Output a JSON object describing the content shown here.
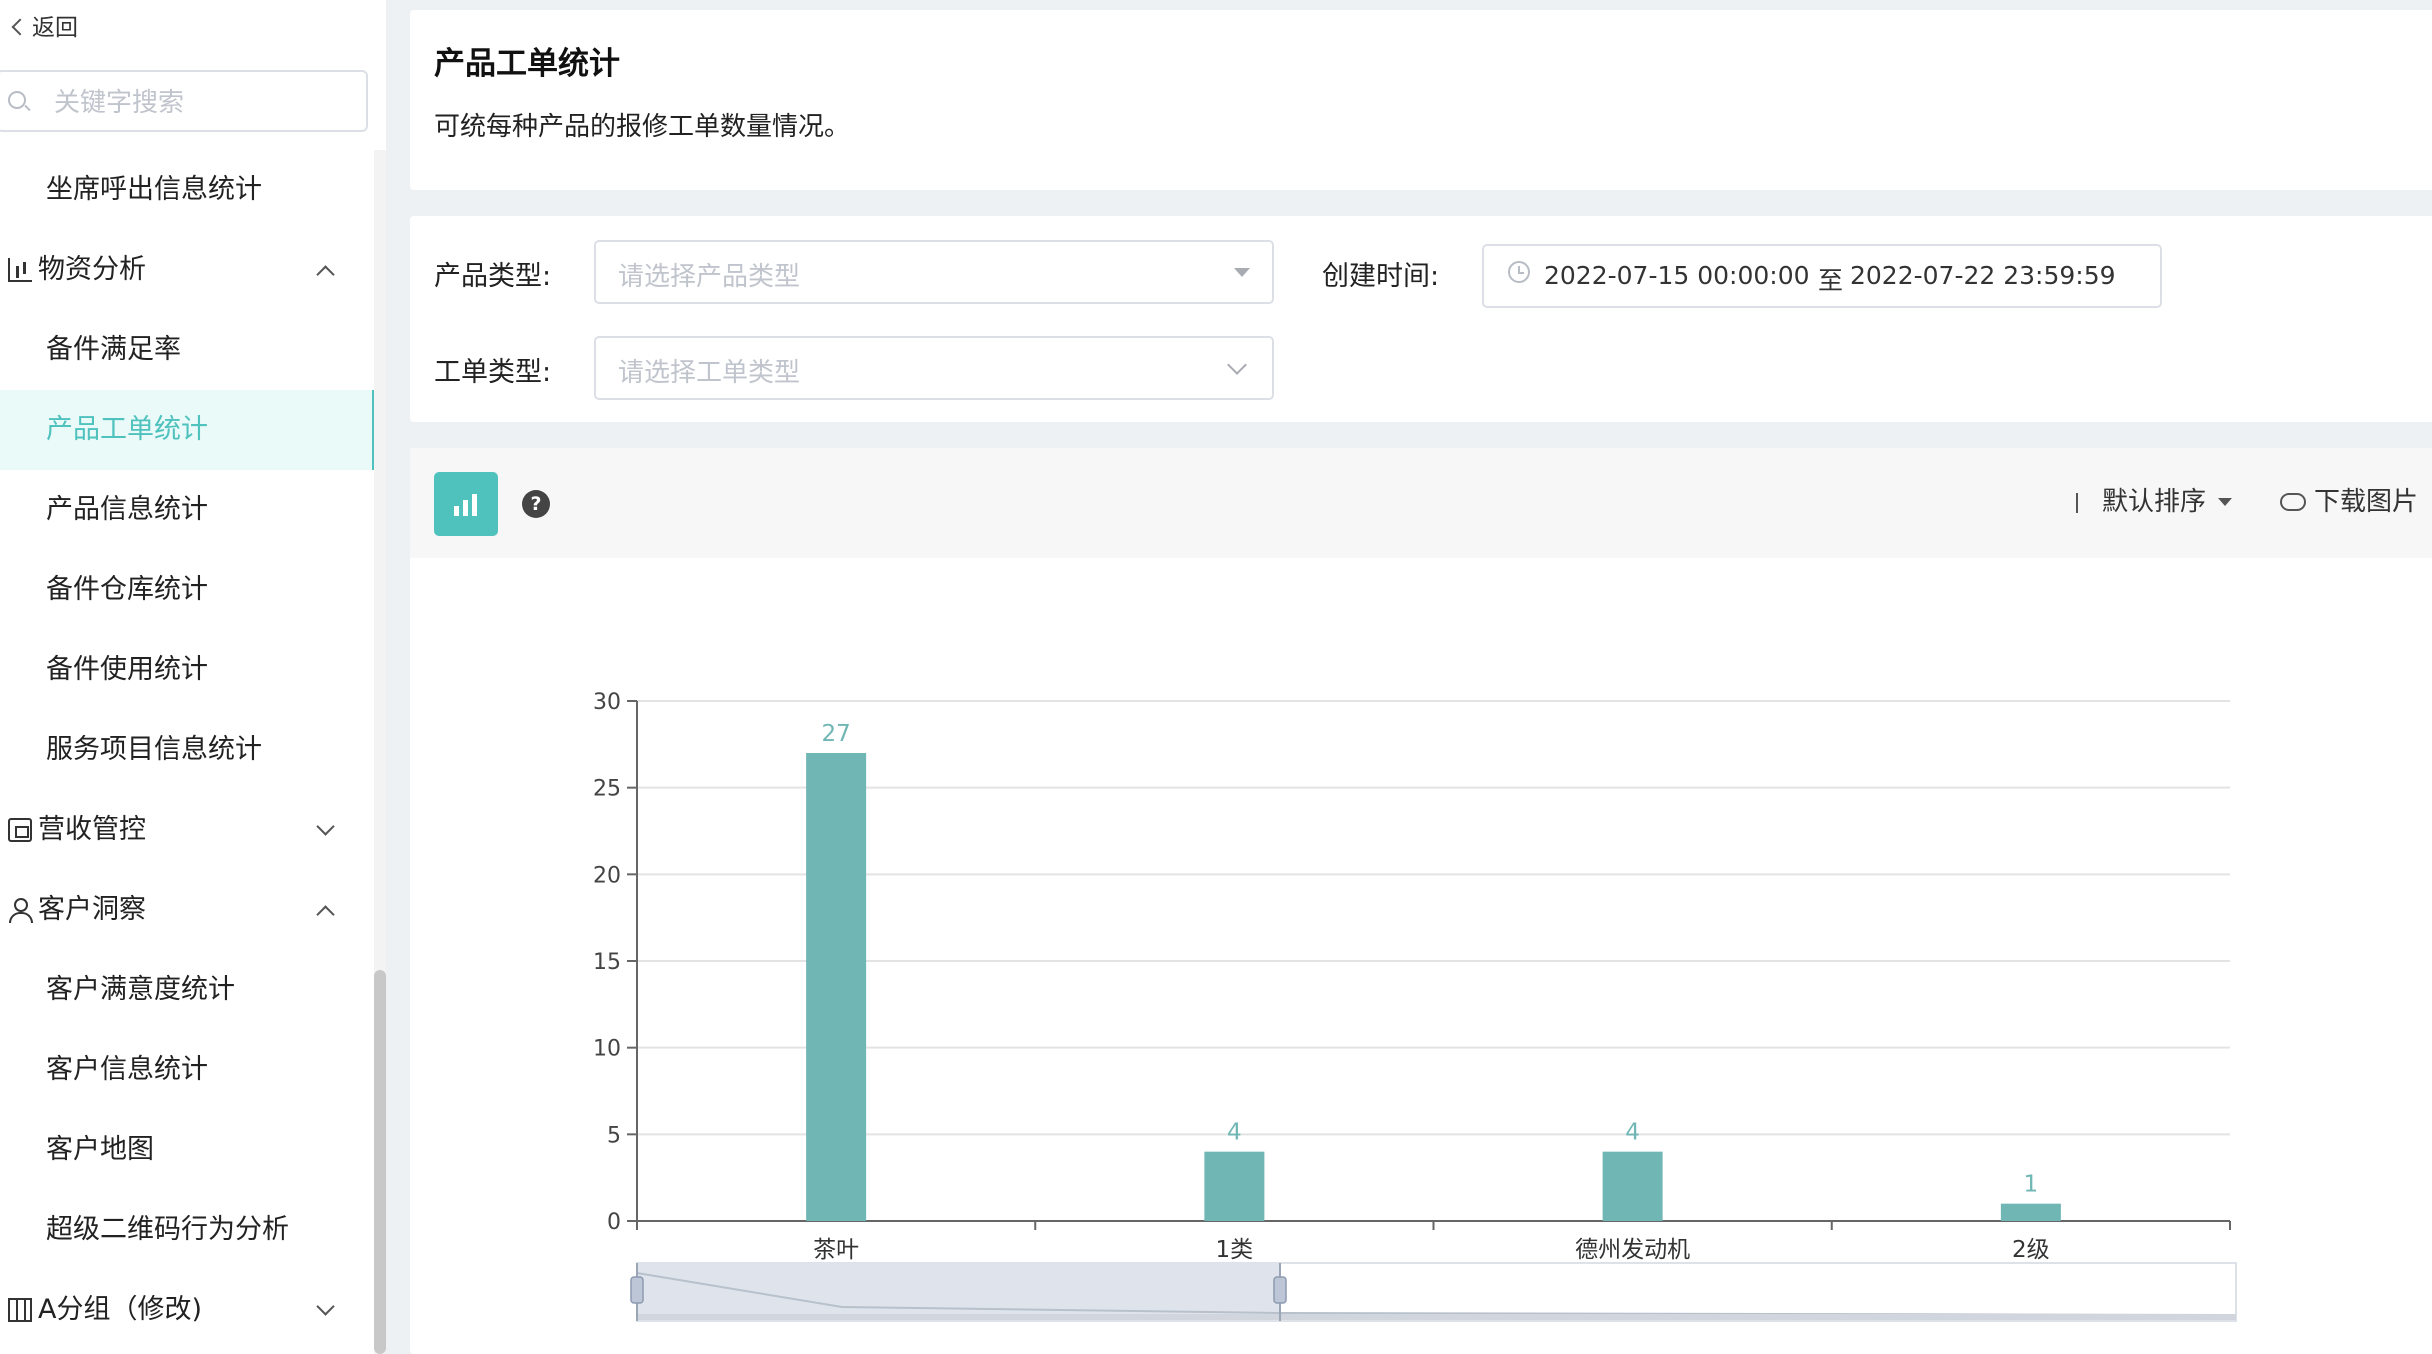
{
  "sidebar": {
    "back_label": "返回",
    "search_placeholder": "关键字搜索",
    "items": [
      {
        "label": "坐席呼出信息统计"
      },
      {
        "label": "物资分析",
        "icon": "bar-chart-icon",
        "expanded": true
      },
      {
        "label": "备件满足率"
      },
      {
        "label": "产品工单统计",
        "active": true
      },
      {
        "label": "产品信息统计"
      },
      {
        "label": "备件仓库统计"
      },
      {
        "label": "备件使用统计"
      },
      {
        "label": "服务项目信息统计"
      },
      {
        "label": "营收管控",
        "icon": "building-icon",
        "expanded": false
      },
      {
        "label": "客户洞察",
        "icon": "user-icon",
        "expanded": true
      },
      {
        "label": "客户满意度统计"
      },
      {
        "label": "客户信息统计"
      },
      {
        "label": "客户地图"
      },
      {
        "label": "超级二维码行为分析"
      },
      {
        "label": "A分组（修改)",
        "icon": "grid-icon",
        "expanded": false
      }
    ]
  },
  "header": {
    "title": "产品工单统计",
    "description": "可统每种产品的报修工单数量情况。"
  },
  "filters": {
    "product_type_label": "产品类型:",
    "product_type_placeholder": "请选择产品类型",
    "created_time_label": "创建时间:",
    "date_start": "2022-07-15 00:00:00",
    "date_sep": "至",
    "date_end": "2022-07-22 23:59:59",
    "order_type_label": "工单类型:",
    "order_type_placeholder": "请选择工单类型"
  },
  "toolbar": {
    "sort_label": "默认排序",
    "download_label": "下载图片",
    "help_glyph": "?"
  },
  "colors": {
    "accent": "#4fc2bd",
    "bar": "#6fb6b4"
  },
  "chart_data": {
    "type": "bar",
    "categories": [
      "茶叶",
      "1类",
      "德州发动机",
      "2级"
    ],
    "values": [
      27,
      4,
      4,
      1
    ],
    "ylim": [
      0,
      30
    ],
    "yticks": [
      0,
      5,
      10,
      15,
      20,
      25,
      30
    ],
    "grid": true,
    "data_labels": true
  }
}
